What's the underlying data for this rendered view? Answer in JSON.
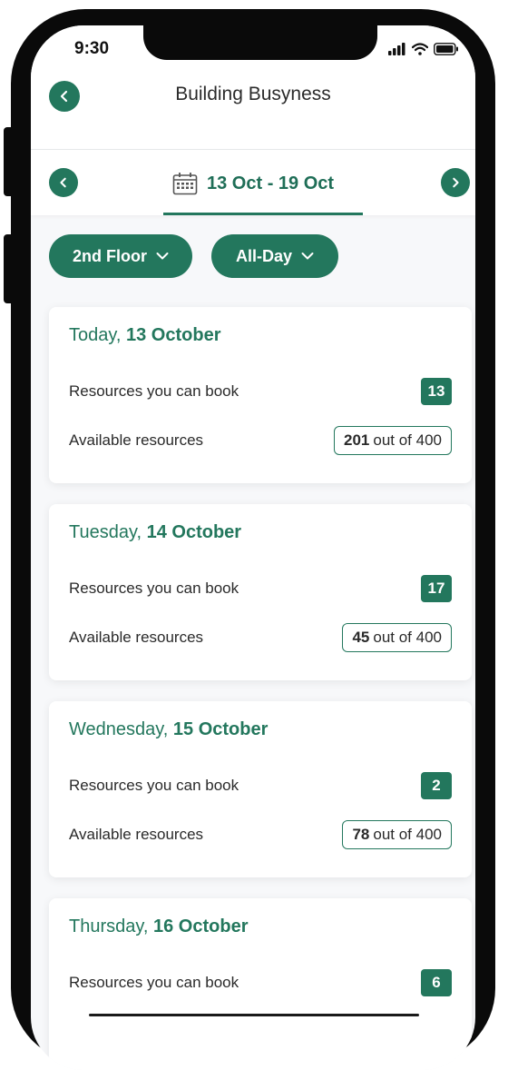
{
  "status": {
    "time": "9:30"
  },
  "header": {
    "title": "Building Busyness"
  },
  "week": {
    "range": "13 Oct - 19 Oct"
  },
  "filters": {
    "floor": "2nd Floor",
    "time": "All-Day"
  },
  "labels": {
    "book": "Resources you can book",
    "available": "Available resources",
    "out_of": "out of 400"
  },
  "days": [
    {
      "prefix": "Today, ",
      "date": "13 October",
      "book": "13",
      "available": "201"
    },
    {
      "prefix": "Tuesday, ",
      "date": "14 October",
      "book": "17",
      "available": "45"
    },
    {
      "prefix": "Wednesday, ",
      "date": "15 October",
      "book": "2",
      "available": "78"
    },
    {
      "prefix": "Thursday, ",
      "date": "16 October",
      "book": "6"
    }
  ],
  "colors": {
    "accent": "#23775d",
    "background": "#f7f8fa"
  }
}
